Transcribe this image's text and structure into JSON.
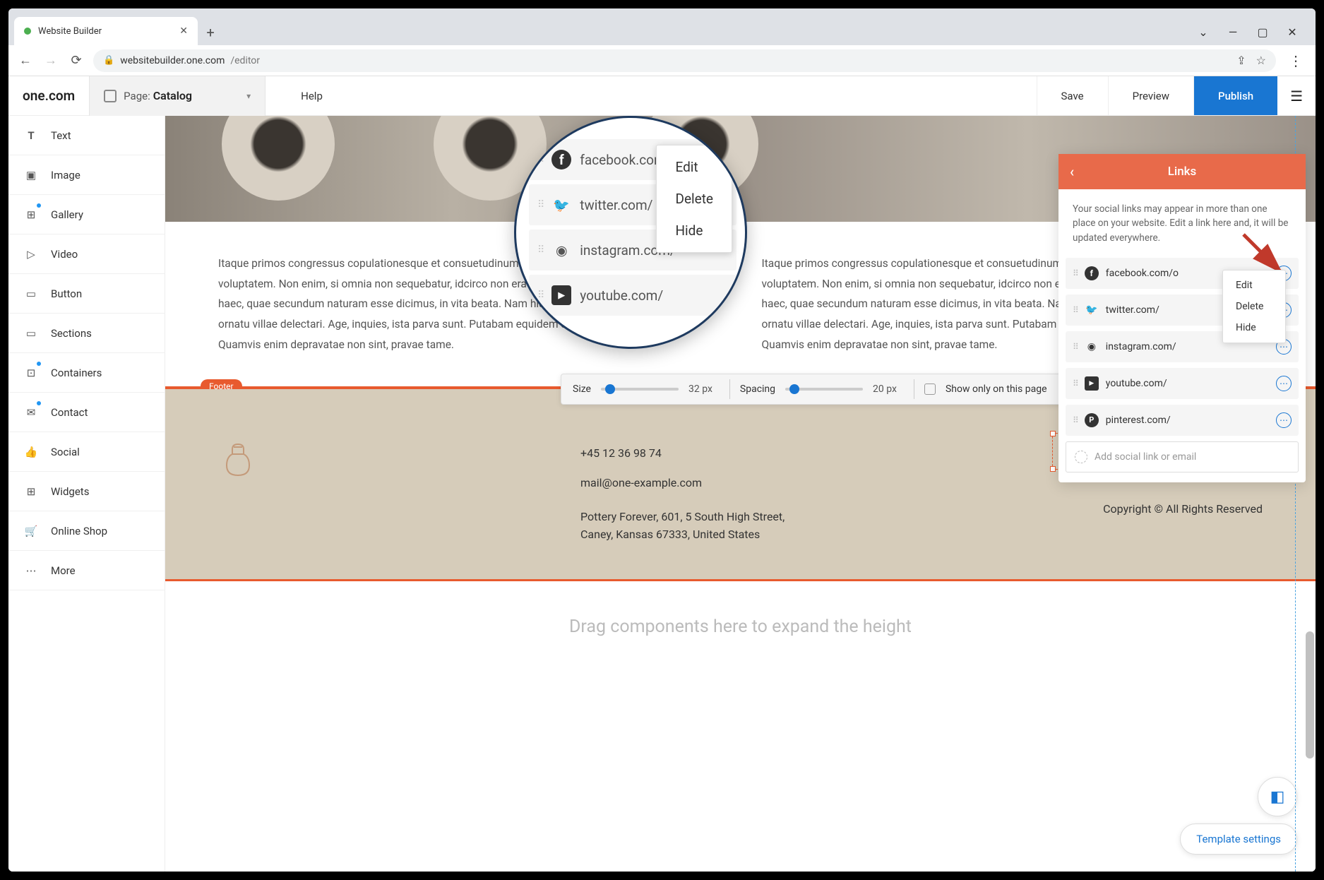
{
  "browser": {
    "tab_title": "Website Builder",
    "url_host": "websitebuilder.one.com",
    "url_path": "/editor"
  },
  "appbar": {
    "logo": "one.com",
    "page_label": "Page:",
    "page_name": "Catalog",
    "help": "Help",
    "save": "Save",
    "preview": "Preview",
    "publish": "Publish"
  },
  "sidebar": {
    "items": [
      {
        "label": "Text"
      },
      {
        "label": "Image"
      },
      {
        "label": "Gallery",
        "badge": true
      },
      {
        "label": "Video"
      },
      {
        "label": "Button"
      },
      {
        "label": "Sections"
      },
      {
        "label": "Containers",
        "badge": true
      },
      {
        "label": "Contact",
        "badge": true
      },
      {
        "label": "Social"
      },
      {
        "label": "Widgets"
      },
      {
        "label": "Online Shop"
      },
      {
        "label": "More"
      }
    ]
  },
  "canvas": {
    "paragraph": "Itaque primos congressus copulationesque et consuetudinum instituendarum voluntates fieri propter voluptatem. Non enim, si omnia non sequebatur, idcirco non erat ortus illinc. Quare obscurentur etiam haec, quae secundum naturam esse dicimus, in vita beata. Nam his libris eum malo quam reliquo ornatu villae delectari. Age, inquies, ista parva sunt. Putabam equidem satis, inquit, me dixisse. Quamvis enim depravatae non sint, pravae tame.",
    "paragraph2": "Itaque primos congressus copulationesque et consuetudinum instituendarum voluntates fieri propter voluptatem. Non enim, si omnia non sequebatur, idcirco non erat ortus illinc. Quare obscurentur etiam haec, quae secundum naturam esse dicimus, in vita beata. Nam his libris eum malo quam reliquo ornatu villae delectari. Age, inquies, ista parva sunt. Putabam equidem satis, inquit, me dixisse. Quamvis enim depravatae non sint, pravae tame.",
    "footer_badge": "Footer",
    "dropzone": "Drag components here to expand the height"
  },
  "footer": {
    "phone": "+45 12 36 98 74",
    "email": "mail@one-example.com",
    "address_line1": "Pottery Forever, 601, 5 South High Street,",
    "address_line2": "Caney, Kansas 67333, United States",
    "copyright": "Copyright © All Rights Reserved"
  },
  "toolbar": {
    "size_label": "Size",
    "size_value": "32 px",
    "spacing_label": "Spacing",
    "spacing_value": "20 px",
    "show_only": "Show only on this page"
  },
  "links_panel": {
    "title": "Links",
    "desc": "Your social links may appear in more than one place on your website. Edit a link here and, it will be updated everywhere.",
    "items": [
      {
        "url": "facebook.com/o"
      },
      {
        "url": "twitter.com/"
      },
      {
        "url": "instagram.com/"
      },
      {
        "url": "youtube.com/"
      },
      {
        "url": "pinterest.com/"
      }
    ],
    "add_placeholder": "Add social link or email",
    "menu": {
      "edit": "Edit",
      "delete": "Delete",
      "hide": "Hide"
    }
  },
  "zoom": {
    "items": [
      {
        "url": "facebook.com/o"
      },
      {
        "url": "twitter.com/"
      },
      {
        "url": "instagram.com/"
      },
      {
        "url": "youtube.com/"
      }
    ],
    "menu": {
      "edit": "Edit",
      "delete": "Delete",
      "hide": "Hide"
    }
  },
  "template_settings": "Template settings"
}
